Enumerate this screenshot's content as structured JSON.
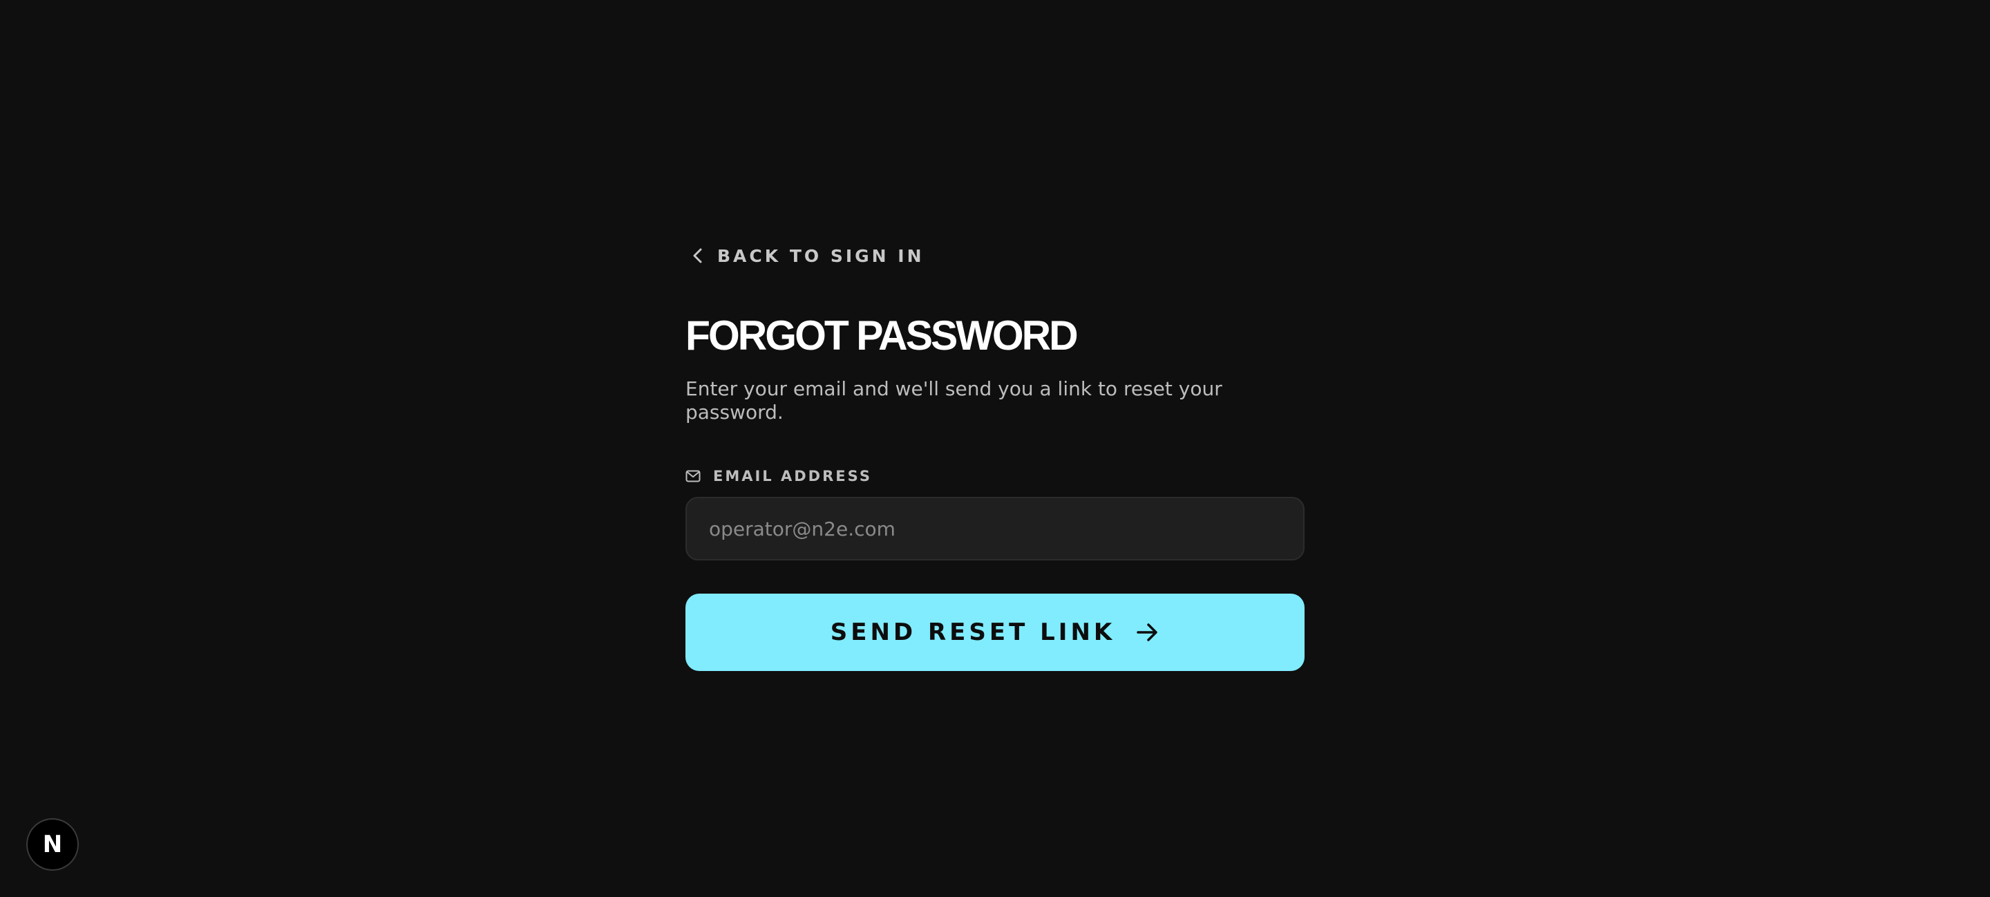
{
  "back_link": {
    "label": "BACK TO SIGN IN",
    "icon": "chevron-left-icon"
  },
  "title": "FORGOT PASSWORD",
  "subtitle": "Enter your email and we'll send you a link to reset your password.",
  "email_field": {
    "label": "EMAIL ADDRESS",
    "icon": "mail-icon",
    "value": "",
    "placeholder": "operator@n2e.com"
  },
  "submit": {
    "label": "SEND RESET LINK",
    "icon": "arrow-right-icon"
  },
  "badge": {
    "letter": "N"
  },
  "colors": {
    "background": "#0f0f0f",
    "input_background": "#1f1f1f",
    "accent": "#80ecfe"
  }
}
